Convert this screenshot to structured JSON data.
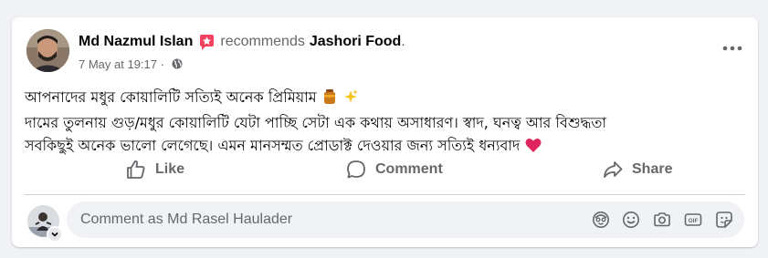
{
  "post": {
    "author": "Md Nazmul Islan",
    "action_text": "recommends",
    "page_name": "Jashori Food",
    "page_suffix": ".",
    "timestamp": "7 May at 19:17",
    "meta_separator": " · ",
    "privacy_icon": "globe-icon",
    "badge_icon": "recommendation-star-icon",
    "more_icon": "more-horizontal-icon",
    "text_lines": [
      "আপনাদের মধুর কোয়ালিটি সত্যিই অনেক প্রিমিয়াম",
      "দামের তুলনায় গুড়/মধুর কোয়ালিটি যেটা পাচ্ছি সেটা এক কথায় অসাধারণ। স্বাদ, ঘনত্ব আর বিশুদ্ধতা",
      "সবকিছুই অনেক ভালো লেগেছে। এমন মানসম্মত প্রোডাক্ট দেওয়ার জন্য সত্যিই ধন্যবাদ"
    ],
    "emojis": [
      "honey-pot-emoji",
      "sparkles-emoji",
      "red-heart-emoji"
    ]
  },
  "actions": {
    "like": "Like",
    "comment": "Comment",
    "share": "Share"
  },
  "comment_box": {
    "placeholder": "Comment as Md Rasel Haulader",
    "icons": [
      "avatar-sticker-icon",
      "emoji-icon",
      "camera-icon",
      "gif-icon",
      "sticker-icon"
    ]
  },
  "colors": {
    "background": "#f0f2f5",
    "card": "#ffffff",
    "primary_text": "#050505",
    "secondary_text": "#65676b",
    "badge": "#f3425f",
    "heart": "#e0245e"
  }
}
